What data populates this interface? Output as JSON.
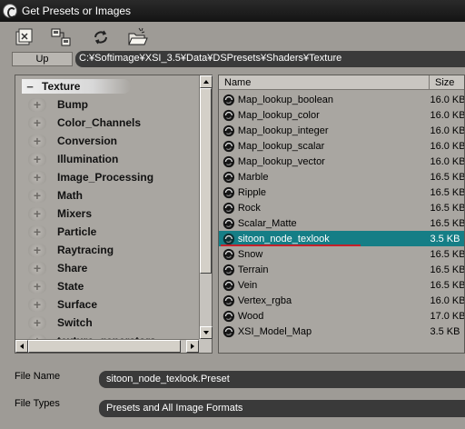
{
  "window": {
    "title": "Get Presets or Images"
  },
  "toolbar": {
    "buttons": [
      {
        "icon": "new-folder-icon"
      },
      {
        "icon": "view-mode-icon"
      },
      {
        "icon": "refresh-icon"
      },
      {
        "icon": "open-folder-icon"
      }
    ],
    "up_label": "Up",
    "path": "C:¥Softimage¥XSI_3.5¥Data¥DSPresets¥Shaders¥Texture"
  },
  "tree": {
    "root": "Texture",
    "items": [
      "Bump",
      "Color_Channels",
      "Conversion",
      "Illumination",
      "Image_Processing",
      "Math",
      "Mixers",
      "Particle",
      "Raytracing",
      "Share",
      "State",
      "Surface",
      "Switch",
      "texture_generators"
    ]
  },
  "file_list": {
    "columns": {
      "name": "Name",
      "size": "Size"
    },
    "rows": [
      {
        "name": "Map_lookup_boolean",
        "size": "16.0 KB"
      },
      {
        "name": "Map_lookup_color",
        "size": "16.0 KB"
      },
      {
        "name": "Map_lookup_integer",
        "size": "16.0 KB"
      },
      {
        "name": "Map_lookup_scalar",
        "size": "16.0 KB"
      },
      {
        "name": "Map_lookup_vector",
        "size": "16.0 KB"
      },
      {
        "name": "Marble",
        "size": "16.5 KB"
      },
      {
        "name": "Ripple",
        "size": "16.5 KB"
      },
      {
        "name": "Rock",
        "size": "16.5 KB"
      },
      {
        "name": "Scalar_Matte",
        "size": "16.5 KB"
      },
      {
        "name": "sitoon_node_texlook",
        "size": "3.5 KB",
        "selected": true
      },
      {
        "name": "Snow",
        "size": "16.5 KB"
      },
      {
        "name": "Terrain",
        "size": "16.5 KB"
      },
      {
        "name": "Vein",
        "size": "16.5 KB"
      },
      {
        "name": "Vertex_rgba",
        "size": "16.0 KB"
      },
      {
        "name": "Wood",
        "size": "17.0 KB"
      },
      {
        "name": "XSI_Model_Map",
        "size": "3.5 KB"
      }
    ]
  },
  "file_name": {
    "label": "File Name",
    "value": "sitoon_node_texlook.Preset"
  },
  "file_types": {
    "label": "File Types",
    "value": "Presets and All Image Formats"
  },
  "colors": {
    "selection": "#157e86",
    "field_bg": "#3a3a3a",
    "panel_bg": "#a9a6a1"
  }
}
